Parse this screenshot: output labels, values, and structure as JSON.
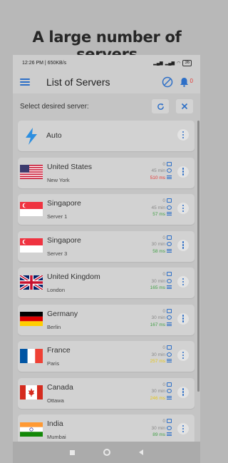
{
  "headline": "A large number of servers",
  "status_bar": {
    "time_speed": "12:26 PM | 650KB/s",
    "battery": "36"
  },
  "app_bar": {
    "title": "List of Servers",
    "notification_count": "0"
  },
  "select_label": "Select desired server:",
  "auto_label": "Auto",
  "servers": [
    {
      "country": "United States",
      "city": "New York",
      "users": "0",
      "time": "45 min",
      "ping": "510 ms",
      "ping_color": "#e53935"
    },
    {
      "country": "Singapore",
      "city": "Server 1",
      "users": "0",
      "time": "45 min",
      "ping": "57 ms",
      "ping_color": "#43a047"
    },
    {
      "country": "Singapore",
      "city": "Server 3",
      "users": "0",
      "time": "30 min",
      "ping": "58 ms",
      "ping_color": "#43a047"
    },
    {
      "country": "United Kingdom",
      "city": "London",
      "users": "0",
      "time": "30 min",
      "ping": "165 ms",
      "ping_color": "#43a047"
    },
    {
      "country": "Germany",
      "city": "Berlin",
      "users": "0",
      "time": "30 min",
      "ping": "167 ms",
      "ping_color": "#43a047"
    },
    {
      "country": "France",
      "city": "Paris",
      "users": "0",
      "time": "30 min",
      "ping": "257 ms",
      "ping_color": "#e6c619"
    },
    {
      "country": "Canada",
      "city": "Ottawa",
      "users": "0",
      "time": "30 min",
      "ping": "246 ms",
      "ping_color": "#e6c619"
    },
    {
      "country": "India",
      "city": "Mumbai",
      "users": "0",
      "time": "30 min",
      "ping": "89 ms",
      "ping_color": "#43a047"
    }
  ],
  "colors": {
    "accent": "#2d6fc7",
    "background": "#b8b8b8"
  }
}
